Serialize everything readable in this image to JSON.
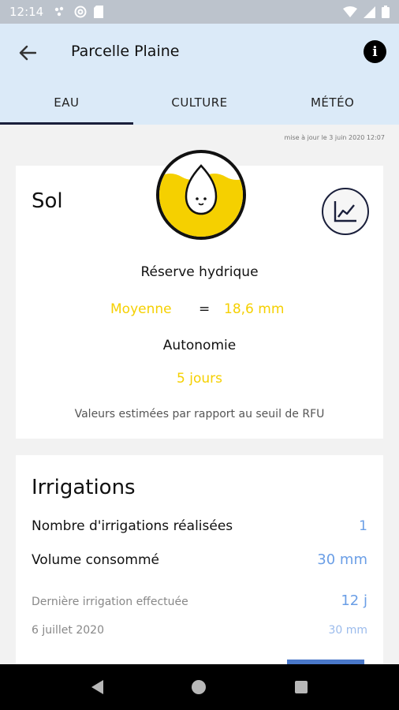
{
  "status_bar": {
    "time": "12:14"
  },
  "header": {
    "title": "Parcelle Plaine"
  },
  "tabs": [
    {
      "label": "EAU",
      "active": true
    },
    {
      "label": "CULTURE",
      "active": false
    },
    {
      "label": "MÉTÉO",
      "active": false
    }
  ],
  "updated_text": "mise à jour le 3 juin 2020 12:07",
  "sol": {
    "title": "Sol",
    "reserve_label": "Réserve hydrique",
    "reserve_level": "Moyenne",
    "equals": "=",
    "reserve_value": "18,6 mm",
    "autonomie_label": "Autonomie",
    "autonomie_value": "5 jours",
    "note": "Valeurs estimées par rapport au seuil de RFU",
    "accent_color": "#f5d000"
  },
  "irrigations": {
    "title": "Irrigations",
    "count_label": "Nombre d'irrigations réalisées",
    "count_value": "1",
    "volume_label": "Volume consommé",
    "volume_value": "30 mm",
    "last_label": "Dernière irrigation effectuée",
    "last_value": "12 j",
    "last_date": "6 juillet 2020",
    "last_volume": "30 mm",
    "accent_color": "#6a9ee6"
  },
  "icons": [
    "back-arrow-icon",
    "info-icon",
    "water-drop-icon",
    "chart-icon"
  ]
}
